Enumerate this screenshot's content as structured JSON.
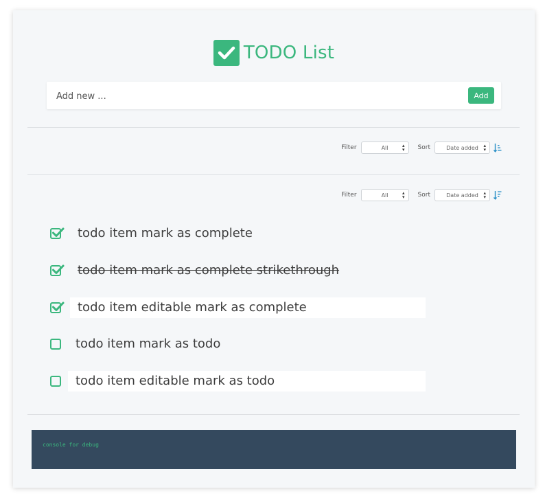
{
  "app": {
    "title": "TODO List"
  },
  "add_bar": {
    "placeholder": "Add new ...",
    "button_label": "Add"
  },
  "toolbars": [
    {
      "filter_label": "Filter",
      "filter_value": "All",
      "sort_label": "Sort",
      "sort_value": "Date added",
      "sort_direction_icon": "sort-ascending-icon"
    },
    {
      "filter_label": "Filter",
      "filter_value": "All",
      "sort_label": "Sort",
      "sort_value": "Date added",
      "sort_direction_icon": "sort-descending-icon"
    }
  ],
  "items": [
    {
      "text": "todo item mark as complete",
      "checked": true,
      "strikethrough": false,
      "editable": false
    },
    {
      "text": "todo item mark as complete strikethrough",
      "checked": true,
      "strikethrough": true,
      "editable": false
    },
    {
      "text": "todo item editable mark as complete",
      "checked": true,
      "strikethrough": false,
      "editable": true
    },
    {
      "text": "todo item mark as todo",
      "checked": false,
      "strikethrough": false,
      "editable": false
    },
    {
      "text": "todo item editable mark as todo",
      "checked": false,
      "strikethrough": false,
      "editable": true
    }
  ],
  "console": {
    "text": "console for debug"
  },
  "colors": {
    "accent": "#3bb77e",
    "console_bg": "#34495e",
    "card_bg": "#f5f7f9"
  }
}
